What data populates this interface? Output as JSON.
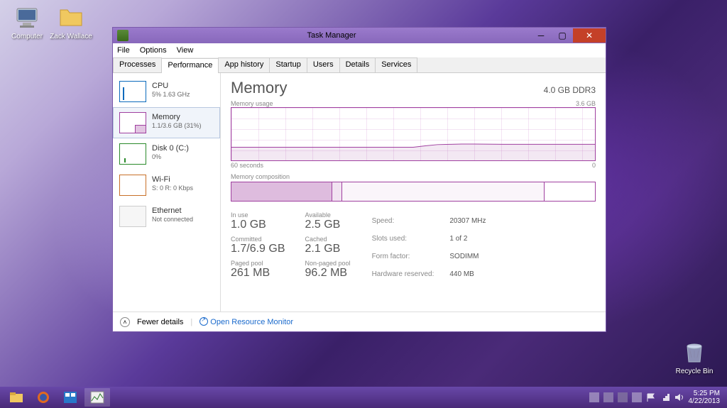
{
  "desktop": {
    "icons": [
      {
        "name": "Computer"
      },
      {
        "name": "Zack Wallace"
      },
      {
        "name": "Recycle Bin"
      }
    ]
  },
  "window": {
    "title": "Task Manager",
    "menu": [
      "File",
      "Options",
      "View"
    ],
    "tabs": [
      "Processes",
      "Performance",
      "App history",
      "Startup",
      "Users",
      "Details",
      "Services"
    ],
    "active_tab": "Performance"
  },
  "resources": [
    {
      "name": "CPU",
      "sub": "5% 1.63 GHz",
      "key": "cpu"
    },
    {
      "name": "Memory",
      "sub": "1.1/3.6 GB (31%)",
      "key": "mem"
    },
    {
      "name": "Disk 0 (C:)",
      "sub": "0%",
      "key": "disk"
    },
    {
      "name": "Wi-Fi",
      "sub": "S: 0 R: 0 Kbps",
      "key": "wifi"
    },
    {
      "name": "Ethernet",
      "sub": "Not connected",
      "key": "eth"
    }
  ],
  "memory_panel": {
    "title": "Memory",
    "spec": "4.0 GB DDR3",
    "usage_label": "Memory usage",
    "usage_max": "3.6 GB",
    "xaxis_left": "60 seconds",
    "xaxis_right": "0",
    "composition_label": "Memory composition",
    "stats": {
      "in_use_lbl": "In use",
      "in_use": "1.0 GB",
      "available_lbl": "Available",
      "available": "2.5 GB",
      "committed_lbl": "Committed",
      "committed": "1.7/6.9 GB",
      "cached_lbl": "Cached",
      "cached": "2.1 GB",
      "paged_lbl": "Paged pool",
      "paged": "261 MB",
      "nonpaged_lbl": "Non-paged pool",
      "nonpaged": "96.2 MB"
    },
    "hw": {
      "speed_lbl": "Speed:",
      "speed": "20307 MHz",
      "slots_lbl": "Slots used:",
      "slots": "1 of 2",
      "form_lbl": "Form factor:",
      "form": "SODIMM",
      "reserved_lbl": "Hardware reserved:",
      "reserved": "440 MB"
    }
  },
  "footer": {
    "fewer": "Fewer details",
    "resmon": "Open Resource Monitor"
  },
  "tray": {
    "time": "5:25 PM",
    "date": "4/22/2013"
  },
  "chart_data": {
    "type": "area",
    "title": "Memory usage",
    "ylabel": "GB",
    "ylim": [
      0,
      3.6
    ],
    "xlabel": "seconds ago",
    "xlim": [
      60,
      0
    ],
    "x": [
      60,
      55,
      50,
      45,
      40,
      35,
      30,
      28,
      26,
      24,
      22,
      20,
      15,
      10,
      5,
      0
    ],
    "values": [
      0.9,
      0.9,
      0.9,
      0.9,
      0.9,
      0.9,
      0.9,
      1.0,
      1.08,
      1.1,
      1.12,
      1.12,
      1.1,
      1.1,
      1.1,
      1.1
    ],
    "composition": {
      "in_use_gb": 1.0,
      "modified_gb": 0.1,
      "standby_gb": 2.0,
      "free_gb": 0.5,
      "total_gb": 3.6
    }
  }
}
